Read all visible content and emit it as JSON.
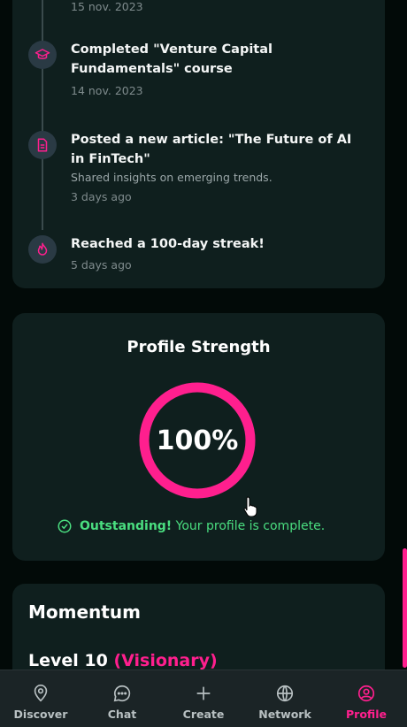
{
  "activity": {
    "items": [
      {
        "title": "",
        "subtitle": "",
        "date": "15 nov. 2023",
        "icon": "partial-icon"
      },
      {
        "title": "Completed \"Venture Capital Fundamentals\" course",
        "subtitle": "",
        "date": "14 nov. 2023",
        "icon": "graduation-cap-icon"
      },
      {
        "title": "Posted a new article: \"The Future of AI in FinTech\"",
        "subtitle": "Shared insights on emerging trends.",
        "date": "3 days ago",
        "icon": "document-icon"
      },
      {
        "title": "Reached a 100-day streak!",
        "subtitle": "",
        "date": "5 days ago",
        "icon": "flame-icon"
      }
    ]
  },
  "profile_strength": {
    "title": "Profile Strength",
    "value_label": "100%",
    "value": 100,
    "message_bold": "Outstanding!",
    "message_rest": "Your profile is complete.",
    "ring_color": "#ff1f8e",
    "message_color": "#4ade80"
  },
  "momentum": {
    "title": "Momentum",
    "level_label": "Level 10",
    "rank_label": "(Visionary)"
  },
  "nav": {
    "items": [
      {
        "label": "Discover",
        "icon": "map-pin-icon",
        "active": false
      },
      {
        "label": "Chat",
        "icon": "chat-bubble-icon",
        "active": false
      },
      {
        "label": "Create",
        "icon": "plus-icon",
        "active": false
      },
      {
        "label": "Network",
        "icon": "globe-icon",
        "active": false
      },
      {
        "label": "Profile",
        "icon": "user-circle-icon",
        "active": true
      }
    ]
  },
  "colors": {
    "accent": "#ff1f8e",
    "background": "#020a08",
    "card": "#0f1f1e",
    "success": "#4ade80"
  }
}
